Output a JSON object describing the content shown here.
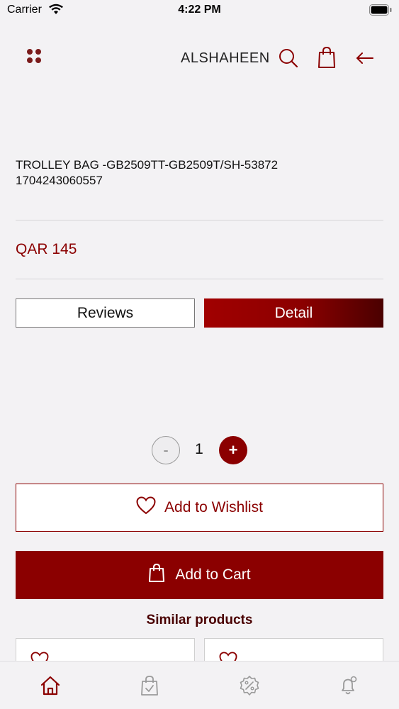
{
  "status_bar": {
    "carrier": "Carrier",
    "time": "4:22 PM"
  },
  "header": {
    "brand": "ALSHAHEEN"
  },
  "product": {
    "title_line1": "TROLLEY BAG -GB2509TT-GB2509T/SH-53872",
    "title_line2": "1704243060557",
    "price": "QAR 145"
  },
  "tabs": {
    "reviews": "Reviews",
    "detail": "Detail",
    "active": "Detail"
  },
  "quantity": {
    "minus": "-",
    "value": "1",
    "plus": "+"
  },
  "actions": {
    "wishlist": "Add to Wishlist",
    "cart": "Add to Cart"
  },
  "similar": {
    "title": "Similar products"
  },
  "colors": {
    "accent": "#8b0000",
    "background": "#f3f2f4",
    "dark_accent": "#4a0000"
  },
  "icons": {
    "menu": "grid-dots-icon",
    "search": "search-icon",
    "bag": "shopping-bag-icon",
    "back": "arrow-left-icon",
    "heart": "heart-icon",
    "home": "home-icon",
    "orders": "bag-check-icon",
    "offers": "percent-badge-icon",
    "notifications": "bell-icon"
  },
  "bottom_nav": {
    "active": "home"
  }
}
